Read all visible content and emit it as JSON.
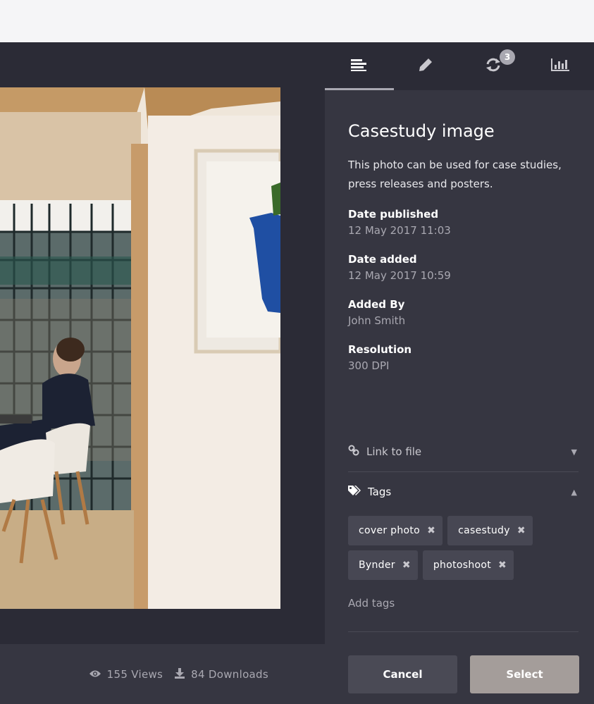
{
  "tabs": [
    {
      "label": "Info",
      "icon": "align-left-icon",
      "active": true
    },
    {
      "label": "Edit",
      "icon": "pencil-icon",
      "active": false
    },
    {
      "label": "Versions",
      "icon": "refresh-icon",
      "active": false,
      "badge": "3"
    },
    {
      "label": "Statistics",
      "icon": "bar-chart-icon",
      "active": false
    }
  ],
  "asset": {
    "title": "Casestudy image",
    "description_line1": "This photo can be used for case studies,",
    "description_line2": "press releases and posters."
  },
  "fields": [
    {
      "label": "Date published",
      "value": "12 May  2017 11:03"
    },
    {
      "label": "Date added",
      "value": "12 May  2017 10:59"
    },
    {
      "label": "Added By",
      "value": "John Smith"
    },
    {
      "label": "Resolution",
      "value": "300 DPI"
    }
  ],
  "link_section": {
    "label": "Link to file",
    "expanded": false
  },
  "tags_section": {
    "label": "Tags",
    "expanded": true,
    "tags": [
      "cover photo",
      "casestudy",
      "Bynder",
      "photoshoot"
    ],
    "add_label": "Add tags"
  },
  "stats": {
    "views": "155 Views",
    "downloads": "84 Downloads"
  },
  "actions": {
    "cancel_label": "Cancel",
    "select_label": "Select"
  },
  "colors": {
    "background": "#2b2b36",
    "panel": "#363641",
    "tag": "#474753",
    "accent": "#a49d9a"
  }
}
